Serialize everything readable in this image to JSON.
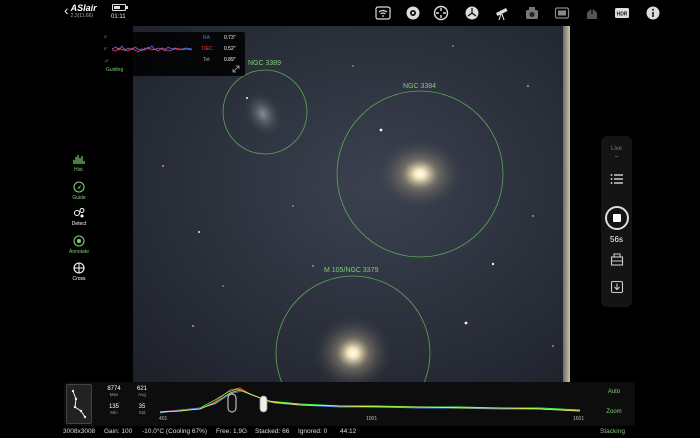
{
  "app": {
    "title": "ASIair",
    "version": "2.3(11.66)",
    "time": "01:11",
    "battery_level": 0.6
  },
  "toolbar_icons": [
    "wifi-icon",
    "camera-icon",
    "focuser-icon",
    "mount-icon",
    "telescope-icon",
    "guide-camera-icon",
    "filter-wheel-icon",
    "dome-icon",
    "hdr-icon",
    "info-icon"
  ],
  "guiding": {
    "axis_top": "4\"",
    "axis_mid": "0\"",
    "axis_bottom": "-4\"",
    "ra_label": "RA",
    "ra_value": "0.73\"",
    "dec_label": "DEC",
    "dec_value": "0.52\"",
    "tot_label": "Tot",
    "tot_value": "0.89\"",
    "label": "Guiding",
    "colors": {
      "ra": "#4a7bff",
      "dec": "#ff3b3b"
    }
  },
  "objects": [
    {
      "name": "NGC 3389"
    },
    {
      "name": "NGC 3384"
    },
    {
      "name": "M 105/NGC 3379"
    }
  ],
  "left_tools": [
    {
      "label": "Hist.",
      "icon": "histogram-icon",
      "color": "#7fcf74"
    },
    {
      "label": "Guide",
      "icon": "guide-icon",
      "color": "#7fcf74"
    },
    {
      "label": "Detect",
      "icon": "detect-icon",
      "color": "#ffffff"
    },
    {
      "label": "Annotate",
      "icon": "annotate-icon",
      "color": "#7fcf74"
    },
    {
      "label": "Cross",
      "icon": "crosshair-icon",
      "color": "#ffffff"
    }
  ],
  "right_panel": {
    "live_label": "Live",
    "exposure": "56s"
  },
  "histogram": {
    "max_value": "8774",
    "max_label": "Max",
    "avg_value": "621",
    "avg_label": "Avg",
    "min_value": "135",
    "min_label": "Min",
    "std_value": "35",
    "std_label": "Std",
    "tick_low": "401",
    "tick_mid": "1001",
    "tick_high": "1601",
    "auto_label": "Auto",
    "zoom_label": "Zoom"
  },
  "status": {
    "resolution": "3008x3008",
    "gain": "Gain: 100",
    "temp": "-10.0°C (Cooling 67%)",
    "free": "Free: 1.9G",
    "stacked": "Stacked: 66",
    "ignored": "Ignored: 0",
    "elapsed": "44:12",
    "mode": "Stacking"
  },
  "colors": {
    "accent_green": "#7fcf74",
    "background": "#000000"
  }
}
